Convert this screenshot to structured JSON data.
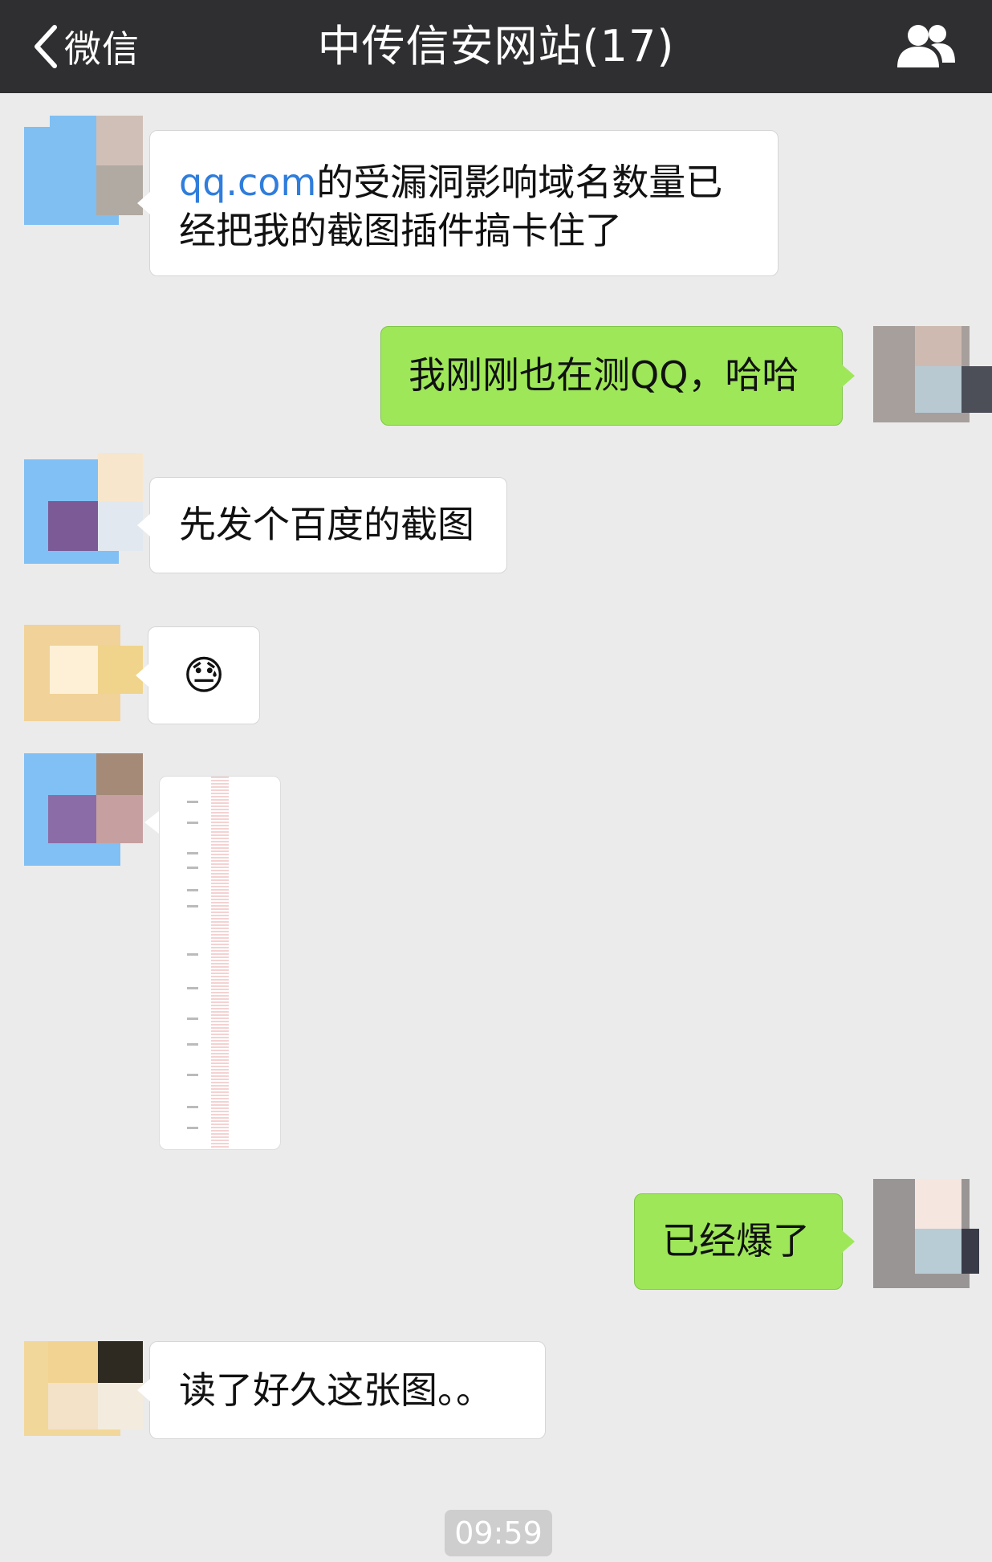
{
  "nav": {
    "back_label": "微信",
    "title": "中传信安网站(17)"
  },
  "messages": [
    {
      "prefix_link": "qq.com",
      "text_line1": "的受漏洞影响域名数量已",
      "text_line2": "经把我的截图插件搞卡住了"
    },
    {
      "text": "我刚刚也在测QQ，哈哈"
    },
    {
      "text": "先发个百度的截图"
    },
    {
      "emoji": "😓"
    },
    {
      "text": "已经爆了"
    },
    {
      "text": "读了好久这张图。。"
    }
  ],
  "timestamp": "09:59",
  "colors": {
    "nav_bg": "#2f2f31",
    "chat_bg": "#ebebeb",
    "outgoing_bubble": "#9ee759",
    "incoming_bubble": "#ffffff",
    "link": "#2f7ddc"
  }
}
